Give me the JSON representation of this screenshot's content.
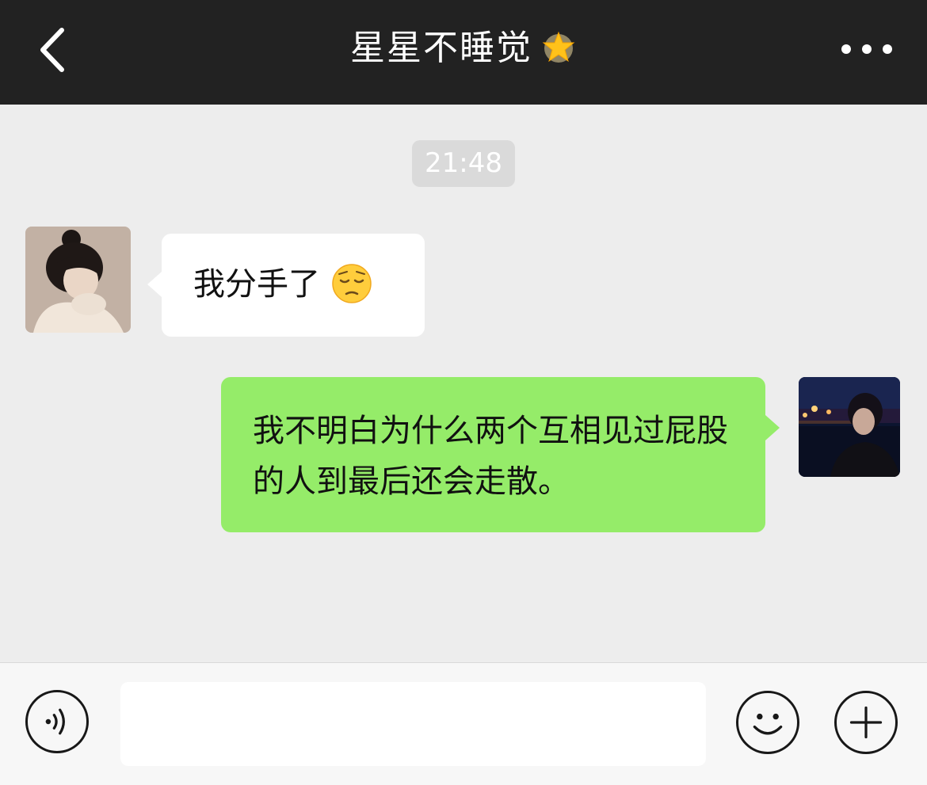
{
  "header": {
    "title": "星星不睡觉",
    "back_icon": "chevron-left-icon",
    "more_icon": "more-dots-icon",
    "title_emoji": "glowing-star-icon"
  },
  "chat": {
    "timestamp": "21:48",
    "messages": [
      {
        "side": "left",
        "text": "我分手了",
        "emoji": "pensive-face-icon"
      },
      {
        "side": "right",
        "text": "我不明白为什么两个互相见过屁股的人到最后还会走散。"
      }
    ]
  },
  "input_bar": {
    "value": "",
    "placeholder": "",
    "voice_icon": "voice-icon",
    "emoji_icon": "smiley-icon",
    "plus_icon": "plus-icon"
  },
  "colors": {
    "header_bg": "#222222",
    "chat_bg": "#ededed",
    "outgoing_bubble": "#95ec69",
    "incoming_bubble": "#ffffff"
  }
}
